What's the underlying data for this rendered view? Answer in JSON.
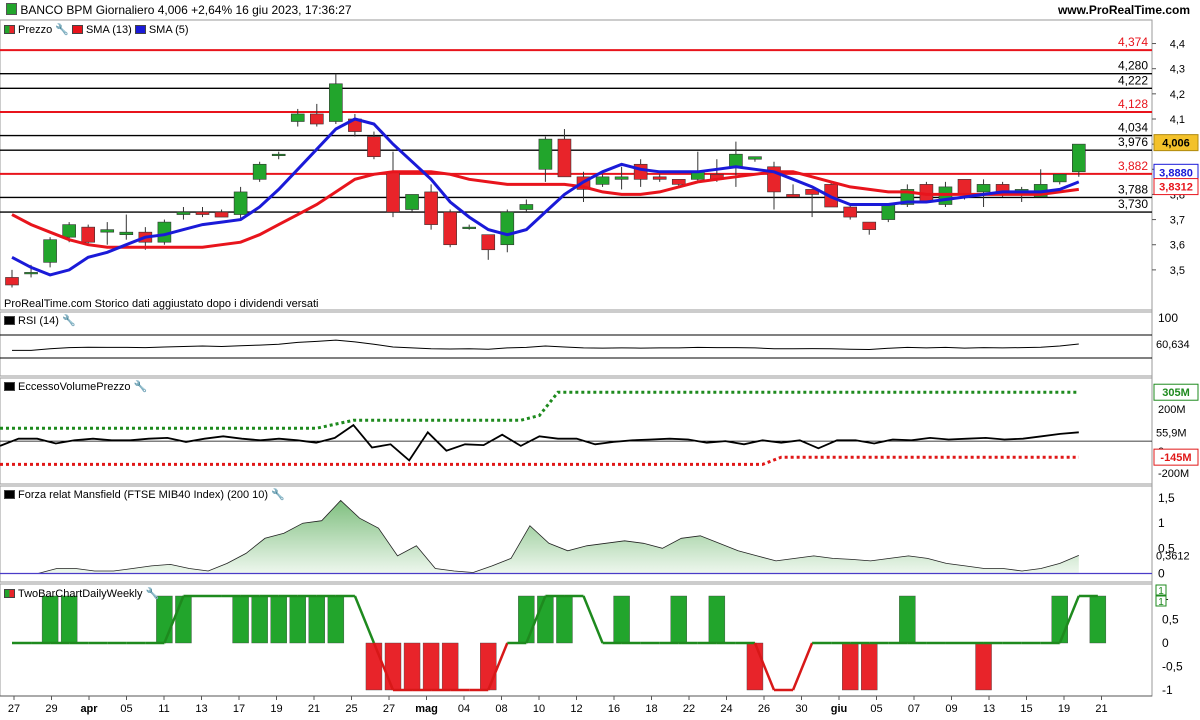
{
  "header": {
    "title": "BANCO BPM Giornaliero 4,006 +2,64% 16 giu 2023, 17:36:27",
    "site": "www.ProRealTime.com"
  },
  "legends": {
    "price": "Prezzo",
    "sma13": "SMA (13)",
    "sma5": "SMA (5)",
    "rsi": "RSI (14)",
    "volume": "EccessoVolumePrezzo",
    "mansfield": "Forza relat Mansfield (FTSE MIB40 Index) (200 10)",
    "twobar": "TwoBarChartDailyWeekly"
  },
  "note": "ProRealTime.com  Storico dati aggiustato dopo i dividendi versati",
  "colors": {
    "up": "#22a52c",
    "down": "#e8242a",
    "sma13": "#e8141c",
    "sma5": "#1a1ad8",
    "green_dot": "#1e8a1e",
    "red_dot": "#e01818"
  },
  "chart_data": [
    {
      "type": "candlestick",
      "panel": "price",
      "x_labels": [
        "27",
        "29",
        "apr",
        "05",
        "11",
        "13",
        "17",
        "19",
        "21",
        "25",
        "27",
        "mag",
        "04",
        "08",
        "10",
        "12",
        "16",
        "18",
        "22",
        "24",
        "26",
        "30",
        "giu",
        "05",
        "07",
        "09",
        "13",
        "15",
        "19",
        "21"
      ],
      "y_ticks": [
        "4,4",
        "4,3",
        "4,2",
        "4,1",
        "4",
        "3,9",
        "3,8",
        "3,7",
        "3,6",
        "3,5"
      ],
      "ylim": [
        3.42,
        4.43
      ],
      "candles": [
        {
          "o": 3.47,
          "h": 3.5,
          "l": 3.43,
          "c": 3.44
        },
        {
          "o": 3.49,
          "h": 3.52,
          "l": 3.47,
          "c": 3.49
        },
        {
          "o": 3.53,
          "h": 3.63,
          "l": 3.51,
          "c": 3.62
        },
        {
          "o": 3.63,
          "h": 3.69,
          "l": 3.61,
          "c": 3.68
        },
        {
          "o": 3.67,
          "h": 3.68,
          "l": 3.6,
          "c": 3.61
        },
        {
          "o": 3.65,
          "h": 3.69,
          "l": 3.6,
          "c": 3.66
        },
        {
          "o": 3.64,
          "h": 3.72,
          "l": 3.62,
          "c": 3.65
        },
        {
          "o": 3.65,
          "h": 3.67,
          "l": 3.58,
          "c": 3.61
        },
        {
          "o": 3.61,
          "h": 3.7,
          "l": 3.6,
          "c": 3.69
        },
        {
          "o": 3.72,
          "h": 3.75,
          "l": 3.7,
          "c": 3.73
        },
        {
          "o": 3.73,
          "h": 3.75,
          "l": 3.71,
          "c": 3.72
        },
        {
          "o": 3.73,
          "h": 3.74,
          "l": 3.71,
          "c": 3.71
        },
        {
          "o": 3.72,
          "h": 3.83,
          "l": 3.7,
          "c": 3.81
        },
        {
          "o": 3.86,
          "h": 3.93,
          "l": 3.85,
          "c": 3.92
        },
        {
          "o": 3.96,
          "h": 3.97,
          "l": 3.94,
          "c": 3.96
        },
        {
          "o": 4.09,
          "h": 4.14,
          "l": 4.07,
          "c": 4.12
        },
        {
          "o": 4.12,
          "h": 4.16,
          "l": 4.07,
          "c": 4.08
        },
        {
          "o": 4.09,
          "h": 4.28,
          "l": 4.08,
          "c": 4.24
        },
        {
          "o": 4.1,
          "h": 4.12,
          "l": 4.03,
          "c": 4.05
        },
        {
          "o": 4.03,
          "h": 4.05,
          "l": 3.94,
          "c": 3.95
        },
        {
          "o": 3.89,
          "h": 3.97,
          "l": 3.71,
          "c": 3.73
        },
        {
          "o": 3.74,
          "h": 3.8,
          "l": 3.73,
          "c": 3.8
        },
        {
          "o": 3.81,
          "h": 3.84,
          "l": 3.66,
          "c": 3.68
        },
        {
          "o": 3.73,
          "h": 3.74,
          "l": 3.59,
          "c": 3.6
        },
        {
          "o": 3.67,
          "h": 3.68,
          "l": 3.66,
          "c": 3.67
        },
        {
          "o": 3.64,
          "h": 3.64,
          "l": 3.54,
          "c": 3.58
        },
        {
          "o": 3.6,
          "h": 3.74,
          "l": 3.57,
          "c": 3.73
        },
        {
          "o": 3.74,
          "h": 3.78,
          "l": 3.73,
          "c": 3.76
        },
        {
          "o": 3.9,
          "h": 4.03,
          "l": 3.85,
          "c": 4.02
        },
        {
          "o": 4.02,
          "h": 4.06,
          "l": 3.87,
          "c": 3.87
        },
        {
          "o": 3.87,
          "h": 3.89,
          "l": 3.77,
          "c": 3.82
        },
        {
          "o": 3.84,
          "h": 3.88,
          "l": 3.83,
          "c": 3.87
        },
        {
          "o": 3.86,
          "h": 3.91,
          "l": 3.82,
          "c": 3.87
        },
        {
          "o": 3.92,
          "h": 3.94,
          "l": 3.83,
          "c": 3.86
        },
        {
          "o": 3.87,
          "h": 3.88,
          "l": 3.85,
          "c": 3.86
        },
        {
          "o": 3.86,
          "h": 3.86,
          "l": 3.83,
          "c": 3.84
        },
        {
          "o": 3.86,
          "h": 3.97,
          "l": 3.85,
          "c": 3.89
        },
        {
          "o": 3.88,
          "h": 3.94,
          "l": 3.85,
          "c": 3.86
        },
        {
          "o": 3.91,
          "h": 4.01,
          "l": 3.83,
          "c": 3.96
        },
        {
          "o": 3.94,
          "h": 3.95,
          "l": 3.93,
          "c": 3.95
        },
        {
          "o": 3.91,
          "h": 3.93,
          "l": 3.74,
          "c": 3.81
        },
        {
          "o": 3.8,
          "h": 3.84,
          "l": 3.79,
          "c": 3.79
        },
        {
          "o": 3.82,
          "h": 3.82,
          "l": 3.71,
          "c": 3.8
        },
        {
          "o": 3.84,
          "h": 3.85,
          "l": 3.75,
          "c": 3.75
        },
        {
          "o": 3.75,
          "h": 3.76,
          "l": 3.7,
          "c": 3.71
        },
        {
          "o": 3.69,
          "h": 3.69,
          "l": 3.64,
          "c": 3.66
        },
        {
          "o": 3.7,
          "h": 3.76,
          "l": 3.69,
          "c": 3.76
        },
        {
          "o": 3.76,
          "h": 3.84,
          "l": 3.75,
          "c": 3.82
        },
        {
          "o": 3.84,
          "h": 3.85,
          "l": 3.77,
          "c": 3.77
        },
        {
          "o": 3.76,
          "h": 3.85,
          "l": 3.75,
          "c": 3.83
        },
        {
          "o": 3.86,
          "h": 3.86,
          "l": 3.78,
          "c": 3.8
        },
        {
          "o": 3.81,
          "h": 3.86,
          "l": 3.75,
          "c": 3.84
        },
        {
          "o": 3.84,
          "h": 3.85,
          "l": 3.79,
          "c": 3.8
        },
        {
          "o": 3.81,
          "h": 3.83,
          "l": 3.77,
          "c": 3.82
        },
        {
          "o": 3.79,
          "h": 3.9,
          "l": 3.79,
          "c": 3.84
        },
        {
          "o": 3.85,
          "h": 3.88,
          "l": 3.84,
          "c": 3.88
        },
        {
          "o": 3.89,
          "h": 3.96,
          "l": 3.87,
          "c": 4.0
        }
      ],
      "sma5": [
        3.55,
        3.51,
        3.48,
        3.5,
        3.55,
        3.57,
        3.6,
        3.63,
        3.64,
        3.66,
        3.68,
        3.69,
        3.7,
        3.75,
        3.82,
        3.9,
        3.98,
        4.06,
        4.1,
        4.08,
        4.0,
        3.93,
        3.86,
        3.77,
        3.71,
        3.66,
        3.64,
        3.66,
        3.73,
        3.8,
        3.85,
        3.89,
        3.92,
        3.9,
        3.89,
        3.89,
        3.89,
        3.9,
        3.91,
        3.9,
        3.89,
        3.86,
        3.83,
        3.79,
        3.76,
        3.76,
        3.76,
        3.77,
        3.77,
        3.78,
        3.79,
        3.8,
        3.81,
        3.81,
        3.81,
        3.82,
        3.85
      ],
      "sma13": [
        3.72,
        3.68,
        3.65,
        3.62,
        3.6,
        3.59,
        3.59,
        3.59,
        3.59,
        3.59,
        3.59,
        3.6,
        3.61,
        3.64,
        3.68,
        3.72,
        3.76,
        3.81,
        3.86,
        3.88,
        3.89,
        3.89,
        3.89,
        3.88,
        3.86,
        3.85,
        3.84,
        3.84,
        3.84,
        3.84,
        3.83,
        3.81,
        3.8,
        3.8,
        3.81,
        3.83,
        3.85,
        3.86,
        3.87,
        3.88,
        3.89,
        3.89,
        3.87,
        3.85,
        3.83,
        3.82,
        3.81,
        3.81,
        3.8,
        3.8,
        3.8,
        3.8,
        3.8,
        3.8,
        3.8,
        3.81,
        3.82
      ],
      "hlines": [
        {
          "value": 4.374,
          "label": "4,374",
          "color": "red"
        },
        {
          "value": 4.28,
          "label": "4,280",
          "color": "black"
        },
        {
          "value": 4.222,
          "label": "4,222",
          "color": "black"
        },
        {
          "value": 4.128,
          "label": "4,128",
          "color": "red"
        },
        {
          "value": 4.034,
          "label": "4,034",
          "color": "black"
        },
        {
          "value": 3.976,
          "label": "3,976",
          "color": "black"
        },
        {
          "value": 3.882,
          "label": "3,882",
          "color": "red"
        },
        {
          "value": 3.788,
          "label": "3,788",
          "color": "black"
        },
        {
          "value": 3.73,
          "label": "3,730",
          "color": "black"
        }
      ],
      "last_value": "4,006",
      "sma5_value": "3,8880",
      "sma13_value": "3,8312"
    },
    {
      "type": "line",
      "panel": "rsi",
      "ylim": [
        0,
        100
      ],
      "y_ticks": [
        "100"
      ],
      "values": [
        33,
        33,
        40,
        45,
        47,
        46,
        46,
        45,
        48,
        50,
        52,
        50,
        53,
        56,
        60,
        68,
        72,
        78,
        70,
        60,
        48,
        44,
        40,
        39,
        40,
        38,
        44,
        46,
        52,
        48,
        44,
        43,
        44,
        43,
        44,
        44,
        46,
        45,
        45,
        44,
        40,
        40,
        41,
        40,
        38,
        37,
        42,
        46,
        44,
        46,
        43,
        45,
        44,
        45,
        47,
        52,
        61
      ],
      "last_value": "60,634"
    },
    {
      "type": "line",
      "panel": "volume",
      "y_ticks": [
        "200M",
        "0",
        "-200M"
      ],
      "ylim": [
        -230,
        350
      ],
      "values": [
        -30,
        15,
        15,
        -15,
        5,
        15,
        5,
        5,
        15,
        20,
        -5,
        15,
        30,
        15,
        5,
        15,
        5,
        -10,
        20,
        100,
        -40,
        -20,
        -120,
        55,
        -60,
        -20,
        -25,
        40,
        -30,
        30,
        15,
        15,
        -20,
        -5,
        5,
        10,
        15,
        10,
        -10,
        0,
        -20,
        5,
        -10,
        5,
        -45,
        5,
        5,
        -15,
        10,
        5,
        20,
        10,
        15,
        20,
        10,
        15,
        30,
        45,
        55
      ],
      "green_level": {
        "values": [
          80,
          80,
          80,
          80,
          80,
          80,
          80,
          80,
          80,
          80,
          80,
          80,
          80,
          80,
          80,
          80,
          80,
          80,
          105,
          130,
          130,
          130,
          130,
          130,
          130,
          130,
          130,
          130,
          130,
          160,
          305,
          305,
          305,
          305,
          305,
          305,
          305,
          305,
          305,
          305,
          305,
          305,
          305,
          305,
          305,
          305,
          305,
          305,
          305,
          305,
          305,
          305,
          305,
          305,
          305,
          305,
          305,
          305,
          305
        ]
      },
      "red_level": {
        "values": [
          -145,
          -145,
          -145,
          -145,
          -145,
          -145,
          -145,
          -145,
          -145,
          -145,
          -145,
          -145,
          -145,
          -145,
          -145,
          -145,
          -145,
          -145,
          -145,
          -145,
          -145,
          -145,
          -145,
          -145,
          -145,
          -145,
          -145,
          -145,
          -145,
          -145,
          -145,
          -145,
          -145,
          -145,
          -145,
          -145,
          -145,
          -145,
          -145,
          -145,
          -145,
          -145,
          -145,
          -145,
          -145,
          -145,
          -145,
          -145,
          -145,
          -145,
          -145,
          -145,
          -145,
          -145,
          -145,
          -145,
          -145,
          -145,
          -145
        ]
      },
      "last_value": "55,9M",
      "upper_value": "305M",
      "lower_value": "-145M"
    },
    {
      "type": "area",
      "panel": "mansfield",
      "y_ticks": [
        "1,5",
        "1",
        "0,5",
        "0"
      ],
      "ylim": [
        -0.05,
        1.6
      ],
      "values": [
        0.0,
        0.0,
        0.0,
        0.1,
        0.1,
        0.05,
        0.05,
        0.1,
        0.15,
        0.18,
        0.1,
        0.05,
        0.2,
        0.4,
        0.7,
        0.8,
        1.0,
        1.05,
        1.45,
        1.1,
        0.9,
        0.35,
        0.55,
        0.1,
        0.05,
        0.02,
        0.15,
        0.3,
        0.95,
        0.6,
        0.45,
        0.55,
        0.6,
        0.65,
        0.6,
        0.5,
        0.7,
        0.75,
        0.6,
        0.45,
        0.35,
        0.25,
        0.3,
        0.35,
        0.3,
        0.28,
        0.25,
        0.3,
        0.35,
        0.3,
        0.2,
        0.15,
        0.1,
        0.1,
        0.05,
        0.1,
        0.2,
        0.36
      ],
      "last_value": "0,3612"
    },
    {
      "type": "bar",
      "panel": "twobar",
      "y_ticks": [
        "1",
        "0,5",
        "0",
        "-0,5",
        "-1"
      ],
      "ylim": [
        -1.1,
        1.1
      ],
      "values": [
        0,
        0,
        1,
        1,
        0,
        0,
        0,
        0,
        1,
        1,
        0,
        0,
        1,
        1,
        1,
        1,
        1,
        1,
        0,
        -1,
        -1,
        -1,
        -1,
        -1,
        0,
        -1,
        0,
        1,
        1,
        1,
        0,
        0,
        1,
        0,
        0,
        1,
        0,
        1,
        0,
        -1,
        0,
        0,
        0,
        0,
        -1,
        -1,
        0,
        1,
        0,
        0,
        0,
        -1,
        0,
        0,
        0,
        1,
        0,
        1
      ],
      "line": [
        0,
        0,
        0,
        0,
        0,
        0,
        0,
        0,
        0,
        1,
        1,
        1,
        1,
        1,
        1,
        1,
        1,
        1,
        1,
        0,
        -1,
        -1,
        -1,
        -1,
        -1,
        -1,
        0,
        0,
        1,
        1,
        1,
        0,
        0,
        0,
        0,
        0,
        0,
        0,
        0,
        0,
        -1,
        -1,
        0,
        0,
        0,
        0,
        0,
        0,
        0,
        0,
        0,
        0,
        0,
        0,
        0,
        0,
        1,
        1
      ],
      "last_values": [
        "1",
        "1"
      ]
    }
  ]
}
